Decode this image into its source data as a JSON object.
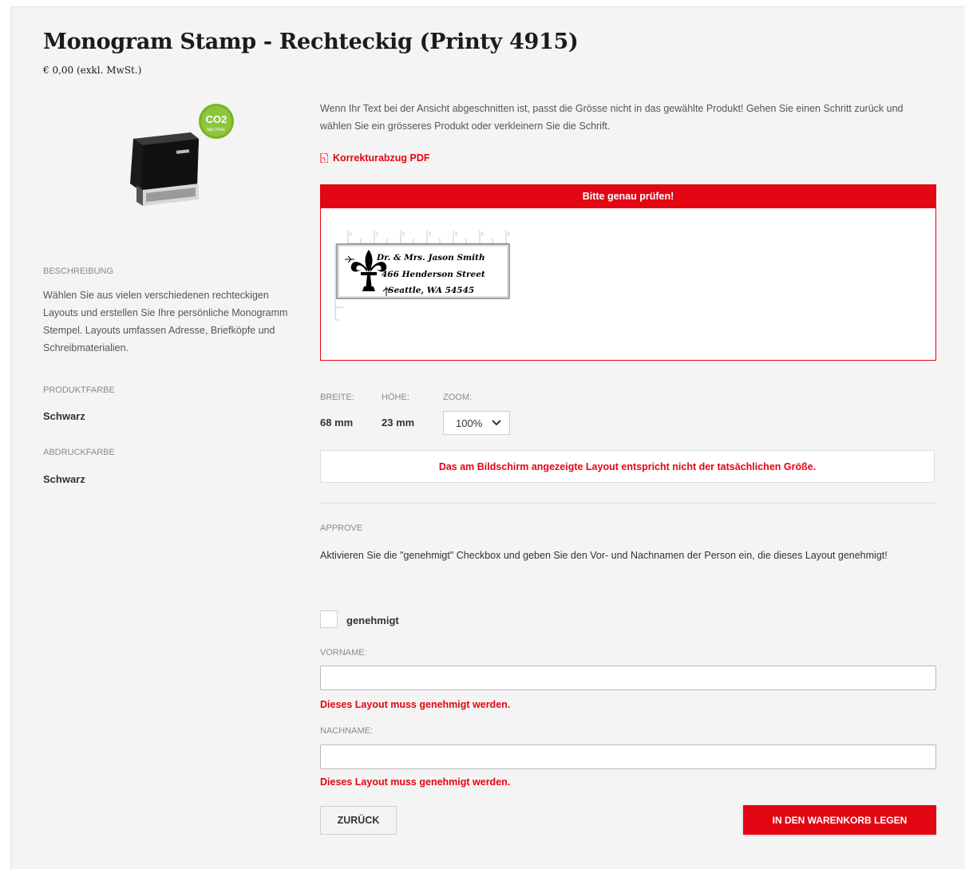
{
  "product": {
    "title": "Monogram Stamp - Rechteckig (Printy 4915)",
    "price": "€ 0,00 (exkl. MwSt.)",
    "image_icon": "stamp-product-image",
    "badge_text": "CO2",
    "badge_subtext": "NEUTRAL"
  },
  "sidebar": {
    "description_label": "BESCHREIBUNG",
    "description_text": "Wählen Sie aus vielen verschiedenen rechteckigen Layouts und erstellen Sie Ihre persönliche Monogramm Stempel. Layouts umfassen Adresse, Briefköpfe und Schreibmaterialien.",
    "product_color_label": "PRODUKTFARBE",
    "product_color_value": "Schwarz",
    "print_color_label": "ABDRUCKFARBE",
    "print_color_value": "Schwarz"
  },
  "main": {
    "notice": "Wenn Ihr Text bei der Ansicht abgeschnitten ist, passt die Grösse nicht in das gewählte Produkt! Gehen Sie einen Schritt zurück und wählen Sie ein grösseres Produkt oder verkleinern Sie die Schrift.",
    "pdf_link": "Korrekturabzug PDF",
    "preview": {
      "header": "Bitte genau prüfen!",
      "lines": [
        "Dr. & Mrs. Jason Smith",
        "466 Henderson Street",
        "Seattle, WA 54545"
      ],
      "ruler_numbers": [
        "0",
        "1",
        "2",
        "3",
        "4",
        "5",
        "6"
      ]
    },
    "dimensions": {
      "width_label": "BREITE:",
      "width_value": "68 mm",
      "height_label": "HÖHE:",
      "height_value": "23 mm",
      "zoom_label": "ZOOM:",
      "zoom_value": "100%"
    },
    "warning": "Das am Bildschirm angezeigte Layout entspricht nicht der tatsächlichen Größe.",
    "approve": {
      "label": "APPROVE",
      "text": "Aktivieren Sie die \"genehmigt\" Checkbox und geben Sie den Vor- und Nachnamen der Person ein, die dieses Layout genehmigt!",
      "checkbox_label": "genehmigt",
      "checked": false
    },
    "form": {
      "firstname_label": "VORNAME:",
      "firstname_value": "",
      "firstname_error": "Dieses Layout muss genehmigt werden.",
      "lastname_label": "NACHNAME:",
      "lastname_value": "",
      "lastname_error": "Dieses Layout muss genehmigt werden."
    },
    "buttons": {
      "back": "ZURÜCK",
      "add_to_cart": "IN DEN WARENKORB LEGEN"
    }
  },
  "colors": {
    "accent": "#e30613",
    "background": "#f4f4f4"
  }
}
